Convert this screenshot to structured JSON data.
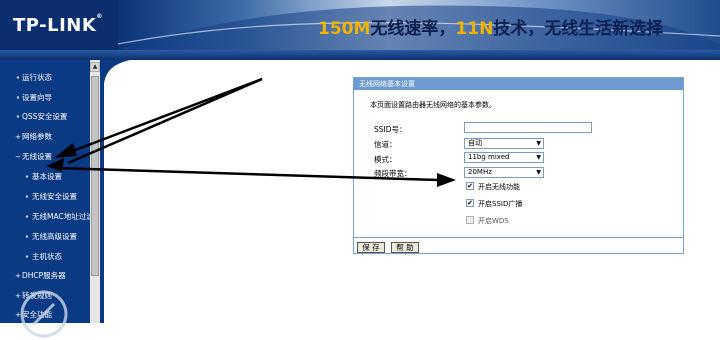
{
  "header": {
    "logo_text": "TP-LINK",
    "logo_mark": "®",
    "slogan_prefix": "150M",
    "slogan_mid1": "无线速率，",
    "slogan_11n": "11N",
    "slogan_rest": "技术，无线生活新选择"
  },
  "sidebar": {
    "items": [
      {
        "label": "运行状态",
        "bullet": "•"
      },
      {
        "label": "设置向导",
        "bullet": "•"
      },
      {
        "label": "QSS安全设置",
        "bullet": "•"
      },
      {
        "label": "网络参数",
        "bullet": "+"
      },
      {
        "label": "无线设置",
        "bullet": "−"
      },
      {
        "label": "基本设置",
        "bullet": "•"
      },
      {
        "label": "无线安全设置",
        "bullet": "•"
      },
      {
        "label": "无线MAC地址过滤",
        "bullet": "•"
      },
      {
        "label": "无线高级设置",
        "bullet": "•"
      },
      {
        "label": "主机状态",
        "bullet": "•"
      },
      {
        "label": "DHCP服务器",
        "bullet": "+"
      },
      {
        "label": "转发规则",
        "bullet": "+"
      },
      {
        "label": "安全功能",
        "bullet": "+"
      }
    ],
    "scroll_up": "▲"
  },
  "panel": {
    "title": "无线网络基本设置",
    "description": "本页面设置路由器无线网络的基本参数。",
    "ssid_label": "SSID号：",
    "ssid_value": "",
    "channel_label": "信道：",
    "channel_value": "自动",
    "mode_label": "模式：",
    "mode_value": "11bg mixed",
    "bandwidth_label": "频段带宽：",
    "bandwidth_value": "20MHz",
    "dropdown_arrow": "▼",
    "checkbox_mark": "✔",
    "enable_wireless": "开启无线功能",
    "enable_ssid_broadcast": "开启SSID广播",
    "enable_wds": "开启WDS",
    "save_button": "保 存",
    "help_button": "帮 助"
  },
  "colors": {
    "sidebar_bg": "#0a3a84",
    "panel_title_bg": "#6e9ad2",
    "header_bg": "#0a2e6e",
    "arrow": "#000000"
  }
}
